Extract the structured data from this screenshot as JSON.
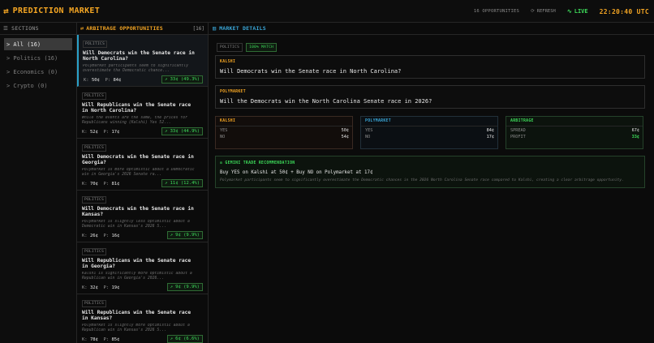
{
  "header": {
    "icon": "swap-arrows-icon",
    "title": "PREDICTION MARKET",
    "opportunities": "16 OPPORTUNITIES",
    "refresh": "REFRESH",
    "live": "LIVE",
    "clock": "22:20:40 UTC"
  },
  "sidebar": {
    "title": "SECTIONS",
    "items": [
      {
        "label": "> All (16)"
      },
      {
        "label": "> Politics (16)"
      },
      {
        "label": "> Economics (0)"
      },
      {
        "label": "> Crypto (0)"
      }
    ]
  },
  "opportunities": {
    "title": "ARBITRAGE OPPORTUNITIES",
    "count": "[16]",
    "cards": [
      {
        "category": "POLITICS",
        "question": "Will Democrats win the Senate race in North Carolina?",
        "desc": "Polymarket participants seem to significantly overestimate the Democratic chance...",
        "k": "50¢",
        "p": "84¢",
        "badge": "↗ 33¢ (49.3%)"
      },
      {
        "category": "POLITICS",
        "question": "Will Republicans win the Senate race in North Carolina?",
        "desc": "While the events are the same, the prices for Republicans winning (Kalshi) Yes 52...",
        "k": "52¢",
        "p": "17¢",
        "badge": "↗ 33¢ (44.9%)"
      },
      {
        "category": "POLITICS",
        "question": "Will Democrats win the Senate race in Georgia?",
        "desc": "Polymarket is more optimistic about a Democratic win in Georgia's 2026 Senate ra...",
        "k": "70¢",
        "p": "81¢",
        "badge": "↗ 11¢ (12.4%)"
      },
      {
        "category": "POLITICS",
        "question": "Will Democrats win the Senate race in Kansas?",
        "desc": "Polymarket is slightly less optimistic about a Democratic win in Kansas's 2026 S...",
        "k": "26¢",
        "p": "16¢",
        "badge": "↗ 9¢ (9.9%)"
      },
      {
        "category": "POLITICS",
        "question": "Will Republicans win the Senate race in Georgia?",
        "desc": "Kalshi is significantly more optimistic about a Republican win in Georgia's 2026...",
        "k": "32¢",
        "p": "19¢",
        "badge": "↗ 9¢ (9.9%)"
      },
      {
        "category": "POLITICS",
        "question": "Will Republicans win the Senate race in Kansas?",
        "desc": "Polymarket is slightly more optimistic about a Republican win in Kansas's 2026 S...",
        "k": "78¢",
        "p": "85¢",
        "badge": "↗ 6¢ (6.6%)"
      }
    ]
  },
  "details": {
    "title": "MARKET DETAILS",
    "category": "POLITICS",
    "match": "100% MATCH",
    "kalshi_label": "KALSHI",
    "kalshi_question": "Will Democrats win the Senate race in North Carolina?",
    "poly_label": "POLYMARKET",
    "poly_question": "Will the Democrats win the North Carolina Senate race in 2026?",
    "kalshi_box": {
      "title": "KALSHI",
      "yes_label": "YES",
      "yes": "50¢",
      "no_label": "NO",
      "no": "54¢"
    },
    "poly_box": {
      "title": "POLYMARKET",
      "yes_label": "YES",
      "yes": "84¢",
      "no_label": "NO",
      "no": "17¢"
    },
    "arb_box": {
      "title": "ARBITRAGE",
      "spread_label": "SPREAD",
      "spread": "67¢",
      "profit_label": "PROFIT",
      "profit": "33¢"
    },
    "rec_title": "◎ GEMINI TRADE RECOMMENDATION",
    "rec_main": "Buy YES on Kalshi at 50¢ + Buy NO on Polymarket at 17¢",
    "rec_sub": "Polymarket participants seem to significantly overestimate the Democratic chances in the 2026 North Carolina Senate race compared to Kalshi, creating a clear arbitrage opportunity."
  },
  "colors": {
    "accent": "#f5a623",
    "blue": "#3aa7d8",
    "green": "#3ddc5a",
    "bg": "#0b0b0b"
  }
}
